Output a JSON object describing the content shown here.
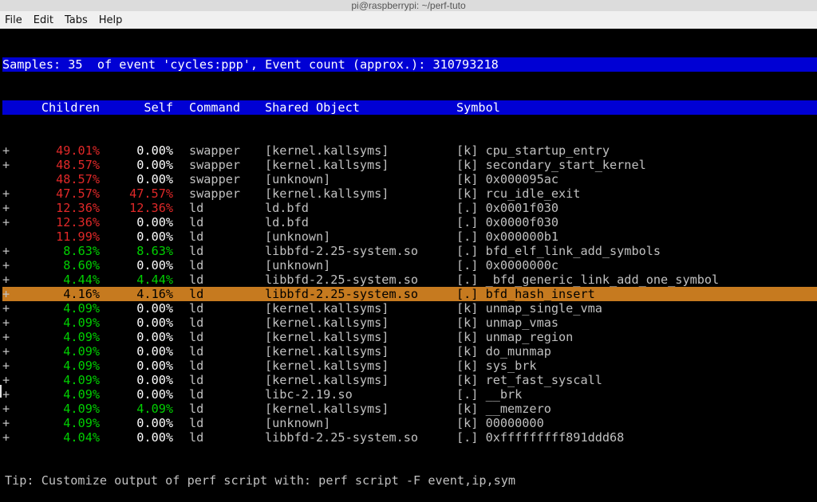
{
  "titlebar": "pi@raspberrypi: ~/perf-tuto",
  "menu": {
    "file": "File",
    "edit": "Edit",
    "tabs": "Tabs",
    "help": "Help"
  },
  "header_line": "Samples: 35  of event 'cycles:ppp', Event count (approx.): 310793218",
  "columns": {
    "children": "Children",
    "self": "Self",
    "command": "Command",
    "shared_object": "Shared Object",
    "symbol": "Symbol"
  },
  "tip": "Tip: Customize output of perf script with: perf script -F event,ip,sym",
  "rows": [
    {
      "plus": "+",
      "children_class": "red",
      "children": "49.01%",
      "self_class": "white",
      "self": "0.00%",
      "cmd": "swapper",
      "obj": "[kernel.kallsyms]",
      "sym": "[k] cpu_startup_entry"
    },
    {
      "plus": "+",
      "children_class": "red",
      "children": "48.57%",
      "self_class": "white",
      "self": "0.00%",
      "cmd": "swapper",
      "obj": "[kernel.kallsyms]",
      "sym": "[k] secondary_start_kernel"
    },
    {
      "plus": " ",
      "children_class": "red",
      "children": "48.57%",
      "self_class": "white",
      "self": "0.00%",
      "cmd": "swapper",
      "obj": "[unknown]",
      "sym": "[k] 0x000095ac"
    },
    {
      "plus": "+",
      "children_class": "red",
      "children": "47.57%",
      "self_class": "red",
      "self": "47.57%",
      "cmd": "swapper",
      "obj": "[kernel.kallsyms]",
      "sym": "[k] rcu_idle_exit"
    },
    {
      "plus": "+",
      "children_class": "red",
      "children": "12.36%",
      "self_class": "red",
      "self": "12.36%",
      "cmd": "ld",
      "obj": "ld.bfd",
      "sym": "[.] 0x0001f030"
    },
    {
      "plus": "+",
      "children_class": "red",
      "children": "12.36%",
      "self_class": "white",
      "self": "0.00%",
      "cmd": "ld",
      "obj": "ld.bfd",
      "sym": "[.] 0x0000f030"
    },
    {
      "plus": " ",
      "children_class": "red",
      "children": "11.99%",
      "self_class": "white",
      "self": "0.00%",
      "cmd": "ld",
      "obj": "[unknown]",
      "sym": "[.] 0x000000b1"
    },
    {
      "plus": "+",
      "children_class": "green",
      "children": "8.63%",
      "self_class": "green",
      "self": "8.63%",
      "cmd": "ld",
      "obj": "libbfd-2.25-system.so",
      "sym": "[.] bfd_elf_link_add_symbols"
    },
    {
      "plus": "+",
      "children_class": "green",
      "children": "8.60%",
      "self_class": "white",
      "self": "0.00%",
      "cmd": "ld",
      "obj": "[unknown]",
      "sym": "[.] 0x0000000c"
    },
    {
      "plus": "+",
      "children_class": "green",
      "children": "4.44%",
      "self_class": "green",
      "self": "4.44%",
      "cmd": "ld",
      "obj": "libbfd-2.25-system.so",
      "sym": "[.] _bfd_generic_link_add_one_symbol"
    },
    {
      "plus": "+",
      "children_class": "green",
      "children": "4.16%",
      "self_class": "green",
      "self": "4.16%",
      "cmd": "ld",
      "obj": "libbfd-2.25-system.so",
      "sym": "[.] bfd_hash_insert",
      "selected": true
    },
    {
      "plus": "+",
      "children_class": "green",
      "children": "4.09%",
      "self_class": "white",
      "self": "0.00%",
      "cmd": "ld",
      "obj": "[kernel.kallsyms]",
      "sym": "[k] unmap_single_vma"
    },
    {
      "plus": "+",
      "children_class": "green",
      "children": "4.09%",
      "self_class": "white",
      "self": "0.00%",
      "cmd": "ld",
      "obj": "[kernel.kallsyms]",
      "sym": "[k] unmap_vmas"
    },
    {
      "plus": "+",
      "children_class": "green",
      "children": "4.09%",
      "self_class": "white",
      "self": "0.00%",
      "cmd": "ld",
      "obj": "[kernel.kallsyms]",
      "sym": "[k] unmap_region"
    },
    {
      "plus": "+",
      "children_class": "green",
      "children": "4.09%",
      "self_class": "white",
      "self": "0.00%",
      "cmd": "ld",
      "obj": "[kernel.kallsyms]",
      "sym": "[k] do_munmap"
    },
    {
      "plus": "+",
      "children_class": "green",
      "children": "4.09%",
      "self_class": "white",
      "self": "0.00%",
      "cmd": "ld",
      "obj": "[kernel.kallsyms]",
      "sym": "[k] sys_brk"
    },
    {
      "plus": "+",
      "children_class": "green",
      "children": "4.09%",
      "self_class": "white",
      "self": "0.00%",
      "cmd": "ld",
      "obj": "[kernel.kallsyms]",
      "sym": "[k] ret_fast_syscall"
    },
    {
      "plus": "+",
      "children_class": "green",
      "children": "4.09%",
      "self_class": "white",
      "self": "0.00%",
      "cmd": "ld",
      "obj": "libc-2.19.so",
      "sym": "[.] __brk"
    },
    {
      "plus": "+",
      "children_class": "green",
      "children": "4.09%",
      "self_class": "green",
      "self": "4.09%",
      "cmd": "ld",
      "obj": "[kernel.kallsyms]",
      "sym": "[k] __memzero"
    },
    {
      "plus": "+",
      "children_class": "green",
      "children": "4.09%",
      "self_class": "white",
      "self": "0.00%",
      "cmd": "ld",
      "obj": "[unknown]",
      "sym": "[k] 00000000"
    },
    {
      "plus": "+",
      "children_class": "green",
      "children": "4.04%",
      "self_class": "white",
      "self": "0.00%",
      "cmd": "ld",
      "obj": "libbfd-2.25-system.so",
      "sym": "[.] 0xfffffffff891ddd68"
    }
  ]
}
